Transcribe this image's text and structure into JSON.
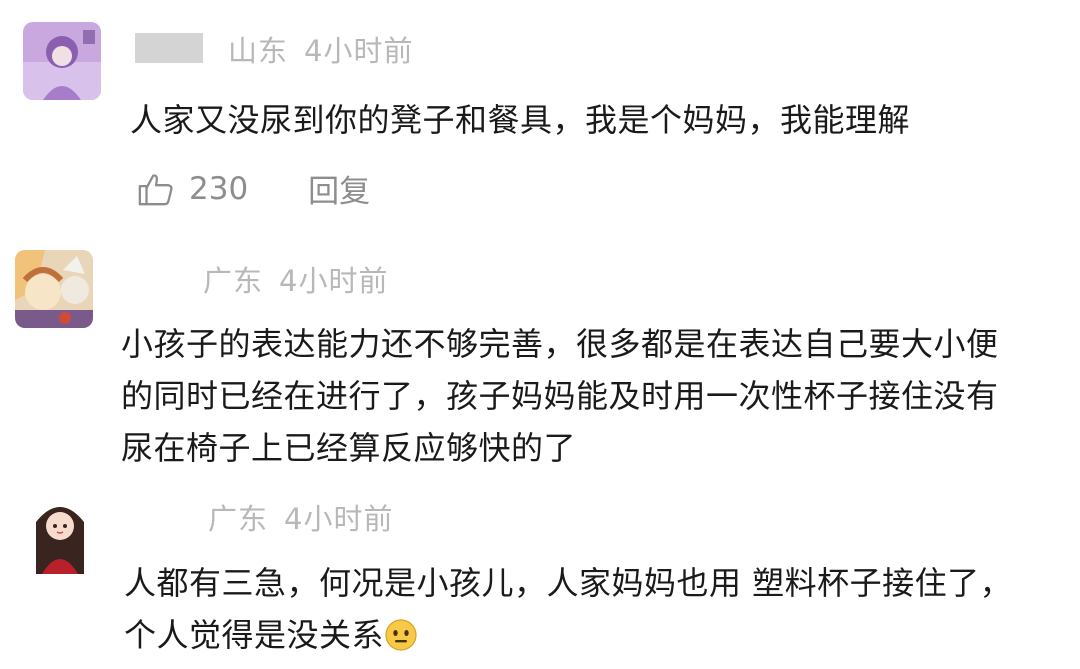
{
  "comments": [
    {
      "username_hidden": true,
      "location": "山东",
      "time": "4小时前",
      "lines": [
        "人家又没尿到你的凳子和餐具，我是个妈妈，我能理解"
      ],
      "likes": "230",
      "reply_label": "回复"
    },
    {
      "username_hidden": true,
      "location": "广东",
      "time": "4小时前",
      "lines": [
        "小孩子的表达能力还不够完善，很多都是在表达自己要大小便",
        "的同时已经在进行了，孩子妈妈能及时用一次性杯子接住没有",
        "尿在椅子上已经算反应够快的了"
      ]
    },
    {
      "username_hidden": true,
      "location": "广东",
      "time": "4小时前",
      "lines": [
        "人都有三急，何况是小孩儿，人家妈妈也用 塑料杯子接住了，",
        "个人觉得是没关系"
      ],
      "emoji": "smile-emoji"
    }
  ],
  "colors": {
    "meta": "#b8b8b8",
    "text": "#1a1a1a",
    "action": "#8d8d8d"
  }
}
